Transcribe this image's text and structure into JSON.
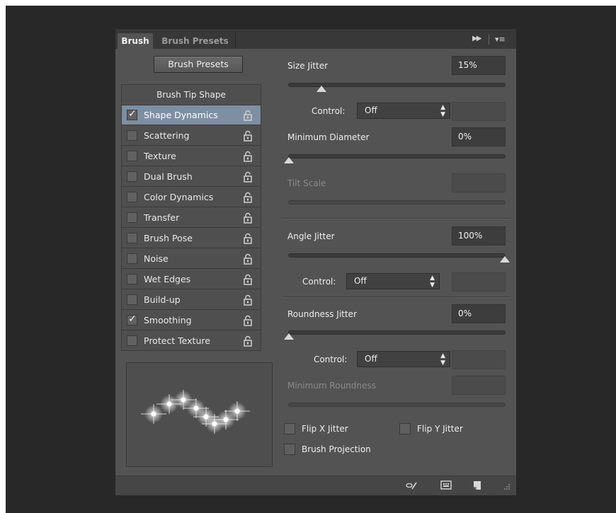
{
  "tabs": [
    {
      "label": "Brush",
      "active": true
    },
    {
      "label": "Brush Presets",
      "active": false
    }
  ],
  "icons": {
    "collapse": "double-chevron-right-icon",
    "menu": "panel-menu-icon",
    "lock": "lock-icon",
    "brush_toggle": "toggle-live-tip-brush-preview-icon",
    "grid": "open-preset-manager-icon",
    "new": "create-new-brush-icon"
  },
  "brush_presets_button": "Brush Presets",
  "options": {
    "header": "Brush Tip Shape",
    "items": [
      {
        "label": "Shape Dynamics",
        "checked": true,
        "selected": true
      },
      {
        "label": "Scattering",
        "checked": false,
        "selected": false
      },
      {
        "label": "Texture",
        "checked": false,
        "selected": false
      },
      {
        "label": "Dual Brush",
        "checked": false,
        "selected": false
      },
      {
        "label": "Color Dynamics",
        "checked": false,
        "selected": false
      },
      {
        "label": "Transfer",
        "checked": false,
        "selected": false
      },
      {
        "label": "Brush Pose",
        "checked": false,
        "selected": false
      },
      {
        "label": "Noise",
        "checked": false,
        "selected": false
      },
      {
        "label": "Wet Edges",
        "checked": false,
        "selected": false
      },
      {
        "label": "Build-up",
        "checked": false,
        "selected": false
      },
      {
        "label": "Smoothing",
        "checked": true,
        "selected": false
      },
      {
        "label": "Protect Texture",
        "checked": false,
        "selected": false
      }
    ]
  },
  "settings": {
    "size_jitter": {
      "label": "Size Jitter",
      "value": "15%",
      "slider": 0.15
    },
    "control1": {
      "label": "Control:",
      "value": "Off"
    },
    "min_diameter": {
      "label": "Minimum Diameter",
      "value": "0%",
      "slider": 0.0
    },
    "tilt_scale": {
      "label": "Tilt Scale",
      "value": ""
    },
    "angle_jitter": {
      "label": "Angle Jitter",
      "value": "100%",
      "slider": 1.0
    },
    "control2": {
      "label": "Control:",
      "value": "Off"
    },
    "roundness_jitter": {
      "label": "Roundness Jitter",
      "value": "0%",
      "slider": 0.0
    },
    "control3": {
      "label": "Control:",
      "value": "Off"
    },
    "min_roundness": {
      "label": "Minimum Roundness",
      "value": ""
    },
    "flip_x": {
      "label": "Flip X Jitter",
      "checked": false
    },
    "flip_y": {
      "label": "Flip Y Jitter",
      "checked": false
    },
    "brush_projection": {
      "label": "Brush Projection",
      "checked": false
    }
  },
  "colors": {
    "panel": "#535353",
    "selected_row": "#7e8fa3",
    "backdrop": "#282828"
  }
}
